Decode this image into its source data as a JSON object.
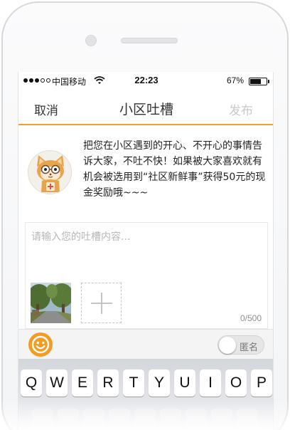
{
  "status_bar": {
    "carrier": "中国移动",
    "time": "22:23",
    "battery_percent": "67%",
    "battery_level": 0.67,
    "signal_icon": "signal-dots-icon",
    "wifi_icon": "wifi-icon"
  },
  "nav": {
    "cancel_label": "取消",
    "title": "小区吐槽",
    "publish_label": "发布"
  },
  "intro": {
    "text": "把您在小区遇到的开心、不开心的事情告诉大家，不吐不快！如果被大家喜欢就有机会被选用到“社区新鲜事”获得50元的现金奖励哦~~~",
    "avatar_icon": "cat-mascot-icon"
  },
  "compose": {
    "placeholder": "请输入您的吐槽内容...",
    "counter": "0/500",
    "add_photo_icon": "plus-icon"
  },
  "toolbar": {
    "emoji_icon": "smiley-icon",
    "anonymous_label": "匿名",
    "anonymous_on": false
  },
  "keyboard": {
    "row1": [
      "Q",
      "W",
      "E",
      "R",
      "T",
      "Y",
      "U",
      "I",
      "O",
      "P"
    ]
  },
  "colors": {
    "accent": "#f0a030",
    "emoji_button": "#f39c1f",
    "publish_disabled": "#c9c9c9"
  }
}
